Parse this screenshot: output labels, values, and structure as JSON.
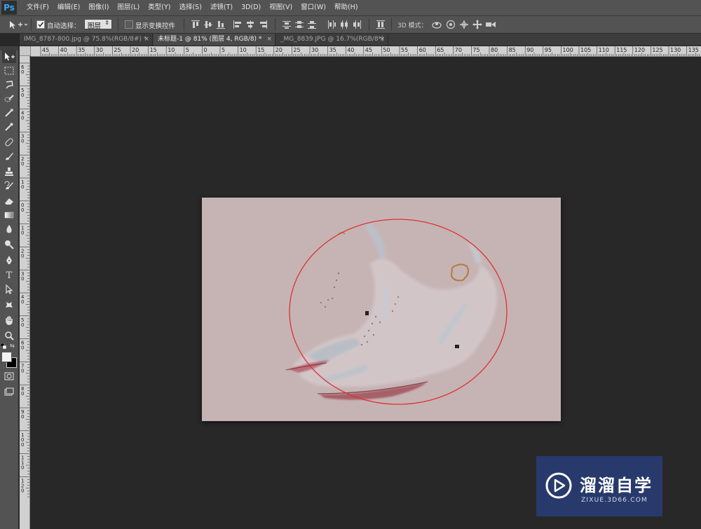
{
  "app": {
    "logo": "Ps"
  },
  "menu": [
    "文件(F)",
    "编辑(E)",
    "图像(I)",
    "图层(L)",
    "类型(Y)",
    "选择(S)",
    "滤镜(T)",
    "3D(D)",
    "视图(V)",
    "窗口(W)",
    "帮助(H)"
  ],
  "options": {
    "auto_select_label": "自动选择：",
    "auto_select_value": "图层",
    "show_transform_label": "显示变换控件",
    "mode_3d_label": "3D 模式："
  },
  "tabs": [
    {
      "label": "IMG_8787-800.jpg @ 75.8%(RGB/8#) *",
      "close": "×"
    },
    {
      "label": "未标题-1 @ 81% (图层 4, RGB/8) *",
      "close": "×"
    },
    {
      "label": "_MG_8839.JPG @ 16.7%(RGB/8*)",
      "close": "×"
    }
  ],
  "ruler_h": [
    "45",
    "40",
    "35",
    "30",
    "25",
    "20",
    "15",
    "10",
    "5",
    "0",
    "5",
    "10",
    "15",
    "20",
    "25",
    "30",
    "35",
    "40",
    "45",
    "50",
    "55",
    "60",
    "65",
    "70",
    "75",
    "80",
    "85",
    "90",
    "95",
    "100",
    "105",
    "110",
    "115",
    "120",
    "125",
    "130",
    "135"
  ],
  "ruler_v": [
    "6",
    "5",
    "4",
    "3",
    "2",
    "1",
    "0",
    "1",
    "2",
    "3",
    "4",
    "5",
    "6",
    "7",
    "8",
    "9",
    "10",
    "11",
    "12"
  ],
  "watermark": {
    "brand": "溜溜自学",
    "url": "ZIXUE.3D66.COM"
  },
  "colors": {
    "canvas": "#c6b4b5",
    "selection_ellipse": "#e03030",
    "watermark_bg": "#283a6b"
  }
}
